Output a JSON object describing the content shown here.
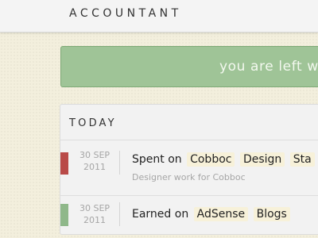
{
  "header": {
    "title": "ACCOUNTANT"
  },
  "notice": {
    "text": "you are left w"
  },
  "section": {
    "heading": "TODAY",
    "entries": [
      {
        "date_day": "30 SEP",
        "date_year": "2011",
        "type_label": "Spent on",
        "tags": [
          "Cobboc",
          "Design",
          "Sta"
        ],
        "note": "Designer work for Cobboc",
        "color": "#b94a48"
      },
      {
        "date_day": "30 SEP",
        "date_year": "2011",
        "type_label": "Earned on",
        "tags": [
          "AdSense",
          "Blogs"
        ],
        "color": "#8fb88a"
      }
    ]
  }
}
